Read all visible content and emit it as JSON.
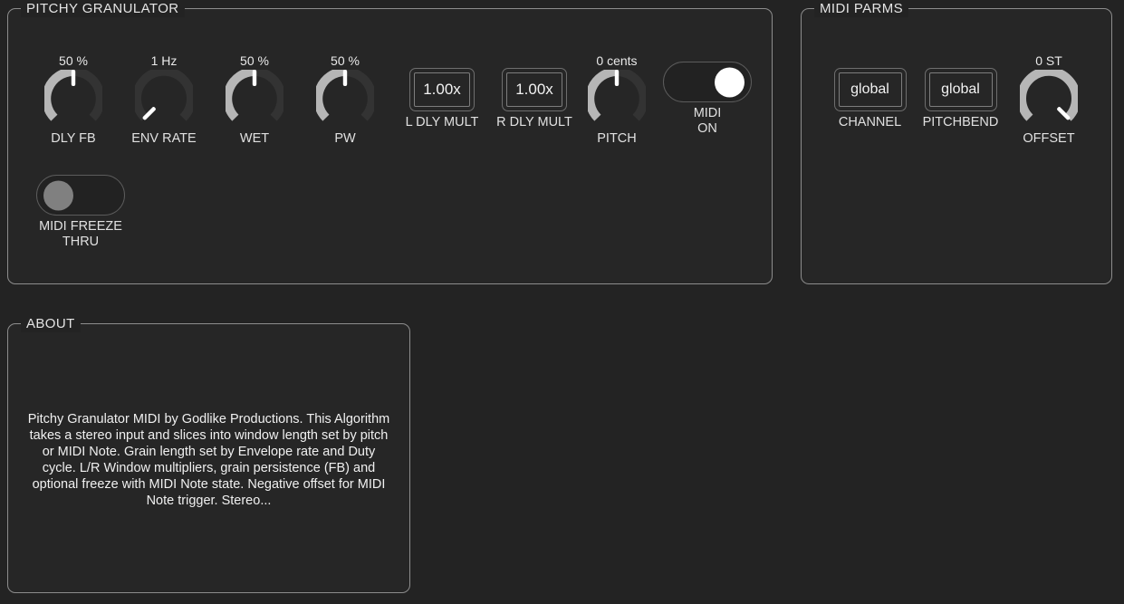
{
  "panels": {
    "granulator": {
      "title": "PITCHY GRANULATOR"
    },
    "midi_parms": {
      "title": "MIDI PARMS"
    },
    "about": {
      "title": "ABOUT"
    }
  },
  "granulator": {
    "knobs": [
      {
        "name": "dly-fb",
        "value": "50 %",
        "caption": "DLY FB",
        "arc_start": 225,
        "arc_end": 90,
        "indicator": 90,
        "filled": true
      },
      {
        "name": "env-rate",
        "value": "1 Hz",
        "caption": "ENV RATE",
        "arc_start": 225,
        "arc_end": 225,
        "indicator": 225,
        "filled": false
      },
      {
        "name": "wet",
        "value": "50 %",
        "caption": "WET",
        "arc_start": 225,
        "arc_end": 90,
        "indicator": 90,
        "filled": true
      },
      {
        "name": "pw",
        "value": "50 %",
        "caption": "PW",
        "arc_start": 225,
        "arc_end": 90,
        "indicator": 90,
        "filled": true
      },
      {
        "name": "pitch",
        "value": "0 cents",
        "caption": "PITCH",
        "arc_start": 225,
        "arc_end": 90,
        "indicator": 90,
        "filled": true
      }
    ],
    "fields": [
      {
        "name": "l-dly-mult",
        "value": "1.00x",
        "caption": "L DLY MULT"
      },
      {
        "name": "r-dly-mult",
        "value": "1.00x",
        "caption": "R DLY MULT"
      }
    ],
    "toggles": [
      {
        "name": "midi-on",
        "caption": "MIDI\nON",
        "state": "on",
        "state_label": "ON"
      },
      {
        "name": "midi-freeze-thru",
        "caption": "MIDI FREEZE\nTHRU",
        "state": "off",
        "state_label": "OFF"
      }
    ]
  },
  "midi_parms": {
    "fields": [
      {
        "name": "channel",
        "value": "global",
        "caption": "CHANNEL"
      },
      {
        "name": "pitchbend",
        "value": "global",
        "caption": "PITCHBEND"
      }
    ],
    "knobs": [
      {
        "name": "offset",
        "value": "0 ST",
        "caption": "OFFSET",
        "arc_start": 225,
        "arc_end": -45,
        "indicator": -45,
        "filled": true
      }
    ]
  },
  "about": {
    "body": "Pitchy Granulator MIDI by Godlike Productions. This Algorithm takes a stereo input and slices into window length set by pitch or MIDI Note. Grain length set by Envelope rate and Duty cycle. L/R Window multipliers, grain persistence (FB) and optional freeze with MIDI Note state. Negative offset for MIDI Note trigger. Stereo..."
  },
  "colors": {
    "background": "#232323",
    "panel": "#262626",
    "border": "#8d8d8d",
    "text": "#e4e4e4",
    "arc_active": "#b6b6b6",
    "arc_track": "#333333",
    "indicator": "#ffffff",
    "toggle_on": "#ffffff",
    "toggle_off": "#808080"
  }
}
